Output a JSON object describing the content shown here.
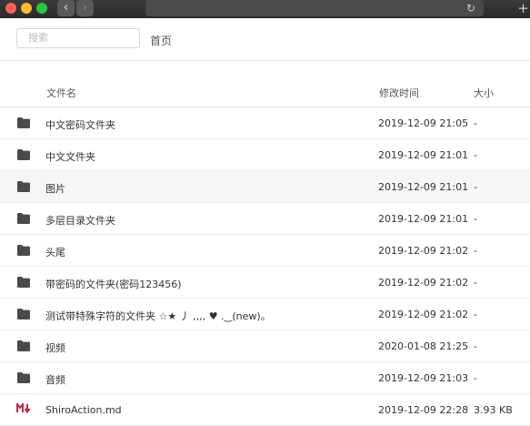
{
  "search": {
    "placeholder": "搜索"
  },
  "breadcrumb": {
    "home": "首页"
  },
  "table": {
    "headers": {
      "name": "文件名",
      "modified": "修改时间",
      "size": "大小"
    },
    "rows": [
      {
        "type": "folder",
        "name": "中文密码文件夹",
        "modified": "2019-12-09 21:05",
        "size": "-"
      },
      {
        "type": "folder",
        "name": "中文文件夹",
        "modified": "2019-12-09 21:01",
        "size": "-"
      },
      {
        "type": "folder",
        "name": "图片",
        "modified": "2019-12-09 21:01",
        "size": "-"
      },
      {
        "type": "folder",
        "name": "多层目录文件夹",
        "modified": "2019-12-09 21:01",
        "size": "-"
      },
      {
        "type": "folder",
        "name": "头尾",
        "modified": "2019-12-09 21:02",
        "size": "-"
      },
      {
        "type": "folder",
        "name": "带密码的文件夹(密码123456)",
        "modified": "2019-12-09 21:02",
        "size": "-"
      },
      {
        "type": "folder",
        "name": "测试带特殊字符的文件夹 ☆★ 丿 ,,,, ♥ .‿(new)。",
        "modified": "2019-12-09 21:02",
        "size": "-"
      },
      {
        "type": "folder",
        "name": "视频",
        "modified": "2020-01-08 21:25",
        "size": "-"
      },
      {
        "type": "folder",
        "name": "音频",
        "modified": "2019-12-09 21:03",
        "size": "-"
      },
      {
        "type": "markdown",
        "name": "ShiroAction.md",
        "modified": "2019-12-09 22:28",
        "size": "3.93 KB"
      }
    ]
  },
  "icons": {
    "folder": "folder-icon",
    "markdown": "markdown-icon"
  },
  "colors": {
    "folder_icon": "#4a4a4a",
    "markdown_icon": "#c0294a",
    "row_highlight": "#f5f6f8"
  }
}
